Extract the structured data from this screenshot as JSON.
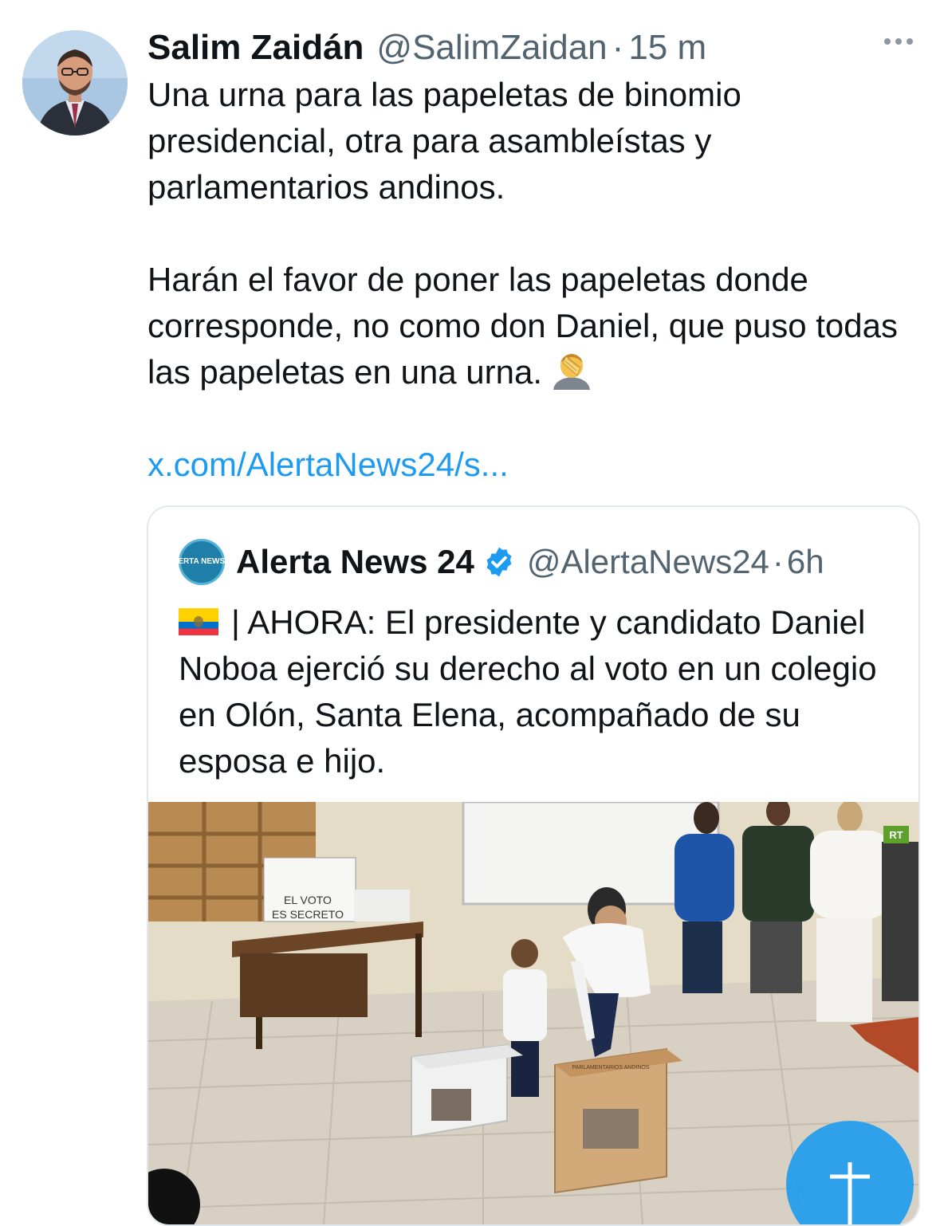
{
  "tweet": {
    "author": {
      "name": "Salim Zaidán",
      "handle": "@SalimZaidan",
      "separator": "·",
      "time": "15 m"
    },
    "text_para1": "Una urna para las papeletas de binomio presidencial, otra para asambleístas y parlamentarios andinos.",
    "text_para2": "Harán el favor de poner las papeletas donde corresponde, no como don Daniel, que puso todas las papeletas en una urna.",
    "link": "x.com/AlertaNews24/s...",
    "more_icon": "more-horizontal-icon",
    "emoji": "facepalm-emoji"
  },
  "quote": {
    "author": {
      "name": "Alerta News 24",
      "handle": "@AlertaNews24",
      "separator": "·",
      "time": "6h",
      "avatar_text": "ALERTA NEWS 24"
    },
    "verified_icon": "verified-badge-icon",
    "flag_icon": "ecuador-flag-icon",
    "text": "| AHORA: El presidente y candidato Daniel Noboa ejerció su derecho al voto en un colegio en Olón, Santa Elena, acompañado de su esposa e hijo.",
    "media": {
      "sign_line1": "EL VOTO",
      "sign_line2": "ES SECRETO",
      "watermark": "RT",
      "box_label": "PARLAMENTARIOS ANDINOS"
    }
  },
  "colors": {
    "link": "#1d9bf0",
    "secondary_text": "#536471",
    "verified": "#1d9bf0"
  }
}
